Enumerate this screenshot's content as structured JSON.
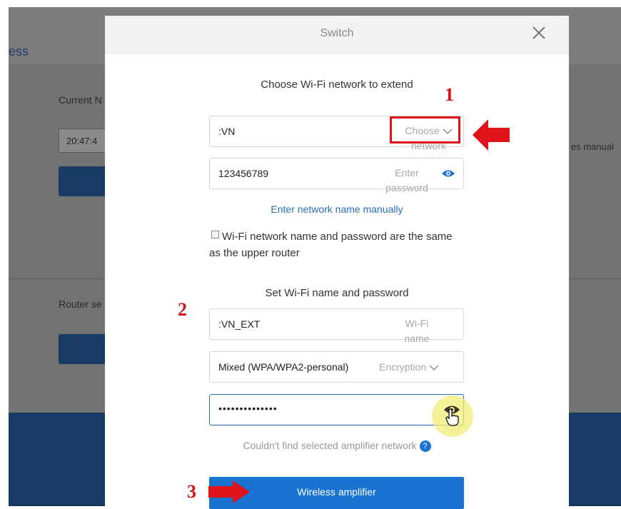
{
  "background": {
    "title_fragment": "ess",
    "current_label": "Current N",
    "time_value": "20:47:4",
    "right_fragment": "es manual",
    "router_label": "Router se"
  },
  "dialog": {
    "title": "Switch",
    "close_icon": "close-icon",
    "extend_heading": "Choose Wi-Fi network to extend",
    "network_value": ":VN",
    "network_hint_1": "Choose",
    "network_hint_2": "network",
    "password_value": "123456789",
    "password_hint_1": "Enter",
    "password_hint_2": "password",
    "manual_link": "Enter network name manually",
    "same_as_upper": "Wi-Fi network name and password are the same as the upper router",
    "set_heading": "Set Wi-Fi name and password",
    "wifi_name_value": ":VN_EXT",
    "wifi_name_hint_1": "Wi-Fi",
    "wifi_name_hint_2": "name",
    "encryption_value": "Mixed (WPA/WPA2-personal)",
    "encryption_hint": "Encryption",
    "new_password_value": "••••••••••••••",
    "help_text": "Couldn't find selected amplifier network",
    "help_icon": "?",
    "submit_label": "Wireless amplifier"
  },
  "annotations": {
    "step1": "1",
    "step2": "2",
    "step3": "3",
    "accent_red": "#e0121a",
    "accent_blue": "#1a73d1"
  }
}
